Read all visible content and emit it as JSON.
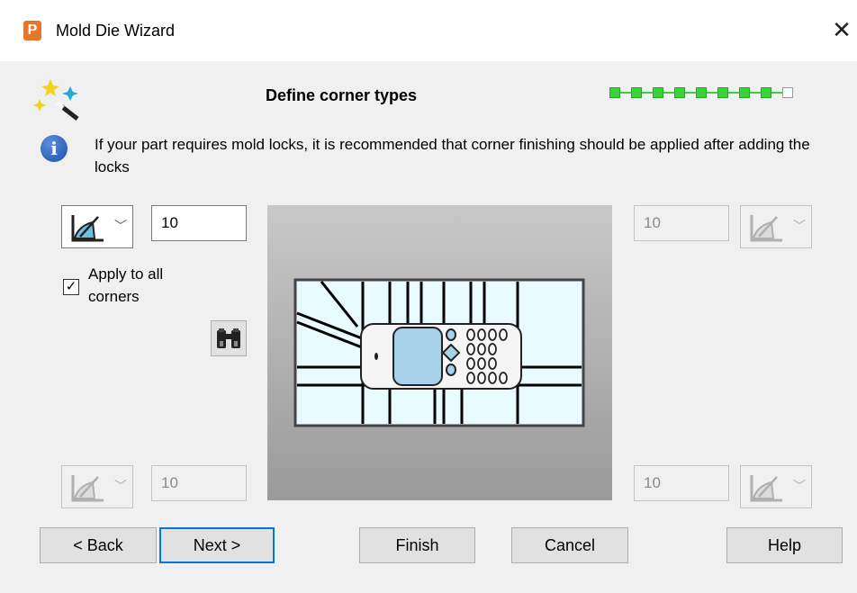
{
  "window": {
    "title": "Mold Die Wizard",
    "app_icon_letter": "P"
  },
  "header": {
    "title": "Define corner types",
    "progress": {
      "completed_steps": 8,
      "total_steps": 9
    }
  },
  "info": {
    "text": "If your part requires mold locks, it is recommended that corner finishing should be applied after adding the locks"
  },
  "corners": {
    "top_left": {
      "value": "10",
      "enabled": true
    },
    "top_right": {
      "value": "10",
      "enabled": false
    },
    "bottom_left": {
      "value": "10",
      "enabled": false
    },
    "bottom_right": {
      "value": "10",
      "enabled": false
    }
  },
  "apply_all": {
    "label": "Apply to all corners",
    "checked": true,
    "check_glyph": "✓"
  },
  "buttons": {
    "back": "< Back",
    "next": "Next >",
    "finish": "Finish",
    "cancel": "Cancel",
    "help": "Help"
  },
  "colors": {
    "progress_done": "#3cd23c",
    "default_button_border": "#0078d7"
  }
}
